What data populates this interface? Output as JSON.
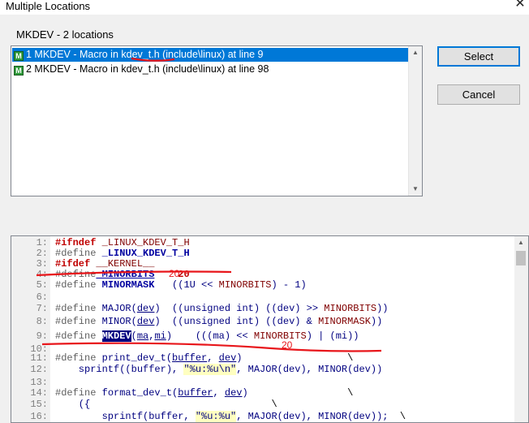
{
  "window": {
    "title": "Multiple Locations"
  },
  "icons": {
    "close": "close-icon",
    "macro": "macro-icon",
    "scroll_up": "arrow-up-icon",
    "scroll_down": "arrow-down-icon"
  },
  "header": {
    "label": "MKDEV - 2 locations"
  },
  "locations": [
    {
      "text": "1 MKDEV - Macro in kdev_t.h (include\\linux) at line 9",
      "selected": true
    },
    {
      "text": "2 MKDEV - Macro in kdev_t.h (include\\linux) at line 98",
      "selected": false
    }
  ],
  "buttons": {
    "select": "Select",
    "cancel": "Cancel"
  },
  "code_lines": [
    {
      "n": "1:",
      "parts": [
        [
          "kw-red",
          "#ifndef"
        ],
        [
          "",
          ""
        ],
        [
          "kw-mac",
          " _LINUX_KDEV_T_H"
        ]
      ]
    },
    {
      "n": "2:",
      "parts": [
        [
          "kw-gray",
          "#define"
        ],
        [
          "kw-blue",
          " _LINUX_KDEV_T_H"
        ]
      ]
    },
    {
      "n": "3:",
      "parts": [
        [
          "kw-red",
          "#ifdef"
        ],
        [
          "kw-mac",
          " __KERNEL__"
        ]
      ]
    },
    {
      "n": "4:",
      "parts": [
        [
          "kw-gray",
          "#define"
        ],
        [
          "kw-blue u",
          " MINORBITS"
        ],
        [
          "kw-red",
          "    20"
        ]
      ]
    },
    {
      "n": "5:",
      "parts": [
        [
          "kw-gray",
          "#define"
        ],
        [
          "kw-blue",
          " MINORMASK"
        ],
        [
          "",
          "   "
        ],
        [
          "kw-navy",
          "((1U << "
        ],
        [
          "kw-mac",
          "MINORBITS"
        ],
        [
          "kw-navy",
          ") - 1)"
        ]
      ]
    },
    {
      "n": "6:",
      "parts": []
    },
    {
      "n": "7:",
      "parts": [
        [
          "kw-gray",
          "#define"
        ],
        [
          "kw-navy",
          " MAJOR("
        ],
        [
          "kw-navy u",
          "dev"
        ],
        [
          "kw-navy",
          ")  ((unsigned int) ((dev) >> "
        ],
        [
          "kw-mac",
          "MINORBITS"
        ],
        [
          "kw-navy",
          "))"
        ]
      ]
    },
    {
      "n": "8:",
      "parts": [
        [
          "kw-gray",
          "#define"
        ],
        [
          "kw-navy",
          " MINOR("
        ],
        [
          "kw-navy u",
          "dev"
        ],
        [
          "kw-navy",
          ")  ((unsigned int) ((dev) & "
        ],
        [
          "kw-mac",
          "MINORMASK"
        ],
        [
          "kw-navy",
          "))"
        ]
      ]
    },
    {
      "n": "9:",
      "parts": [
        [
          "kw-gray",
          "#define "
        ],
        [
          "kw-hl",
          "MKDEV"
        ],
        [
          "kw-navy",
          "("
        ],
        [
          "kw-navy u",
          "ma"
        ],
        [
          "kw-navy",
          ","
        ],
        [
          "kw-navy u",
          "mi"
        ],
        [
          "kw-navy",
          ")    (((ma) << "
        ],
        [
          "kw-mac",
          "MINORBITS"
        ],
        [
          "kw-navy",
          ") | (mi))"
        ]
      ]
    },
    {
      "n": "10:",
      "parts": []
    },
    {
      "n": "11:",
      "parts": [
        [
          "kw-gray",
          "#define"
        ],
        [
          "kw-navy",
          " print_dev_t("
        ],
        [
          "kw-navy u",
          "buffer"
        ],
        [
          "kw-navy",
          ", "
        ],
        [
          "kw-navy u",
          "dev"
        ],
        [
          "kw-navy",
          ")"
        ],
        [
          "",
          "                  \\"
        ]
      ]
    },
    {
      "n": "12:",
      "parts": [
        [
          "kw-navy",
          "    sprintf((buffer), "
        ],
        [
          "kw-str",
          "\"%u:%u\\n\""
        ],
        [
          "kw-navy",
          ", MAJOR(dev), MINOR(dev))"
        ]
      ]
    },
    {
      "n": "13:",
      "parts": []
    },
    {
      "n": "14:",
      "parts": [
        [
          "kw-gray",
          "#define"
        ],
        [
          "kw-navy",
          " format_dev_t("
        ],
        [
          "kw-navy u",
          "buffer"
        ],
        [
          "kw-navy",
          ", "
        ],
        [
          "kw-navy u",
          "dev"
        ],
        [
          "kw-navy",
          ")"
        ],
        [
          "",
          "                 \\"
        ]
      ]
    },
    {
      "n": "15:",
      "parts": [
        [
          "kw-navy",
          "    ({"
        ],
        [
          "",
          "                               \\"
        ]
      ]
    },
    {
      "n": "16:",
      "parts": [
        [
          "kw-navy",
          "        sprintf(buffer, "
        ],
        [
          "kw-str",
          "\"%u:%u\""
        ],
        [
          "kw-navy",
          ", MAJOR(dev), MINOR(dev));"
        ],
        [
          "",
          "  \\"
        ]
      ]
    }
  ],
  "annotations": {
    "note_line4": "20",
    "note_line10": "20",
    "ink_color": "#e8161b"
  }
}
